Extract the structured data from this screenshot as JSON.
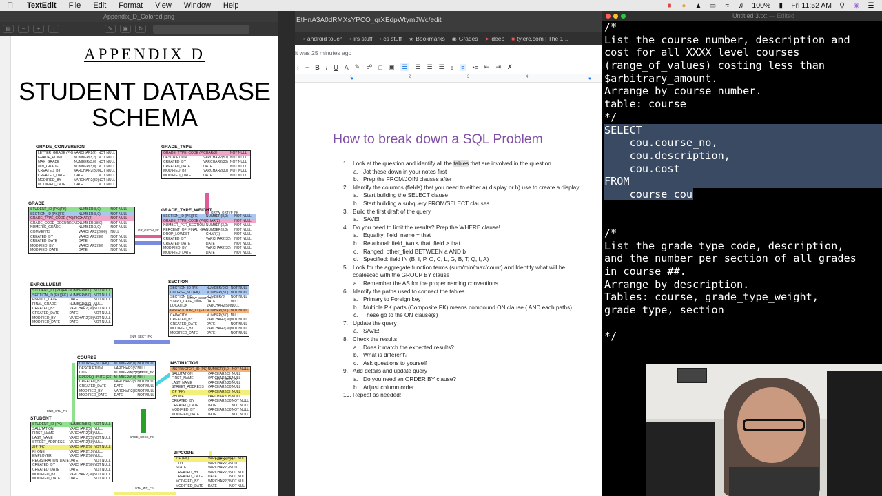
{
  "menubar": {
    "app_name": "TextEdit",
    "items": [
      "File",
      "Edit",
      "Format",
      "View",
      "Window",
      "Help"
    ],
    "battery": "100%",
    "clock": "Fri 11:52 AM"
  },
  "preview": {
    "filename": "Appendix_D_Colored.png",
    "appendix_title": "APPENDIX D",
    "schema_title_line1": "STUDENT DATABASE",
    "schema_title_line2": "SCHEMA",
    "tables": [
      {
        "name": "GRADE_CONVERSION",
        "rows": [
          [
            "LETTER_GRADE (PK)",
            "VARCHAR2(2)",
            "NOT NULL"
          ],
          [
            "GRADE_POINT",
            "NUMBER(3,2)",
            "NOT NULL"
          ],
          [
            "MAX_GRADE",
            "NUMBER(3,0)",
            "NOT NULL"
          ],
          [
            "MIN_GRADE",
            "NUMBER(3,0)",
            "NOT NULL"
          ],
          [
            "CREATED_BY",
            "VARCHAR2(30)",
            "NOT NULL"
          ],
          [
            "CREATED_DATE",
            "DATE",
            "NOT NULL"
          ],
          [
            "MODIFIED_BY",
            "VARCHAR2(30)",
            "NOT NULL"
          ],
          [
            "MODIFIED_DATE",
            "DATE",
            "NOT NULL"
          ]
        ]
      },
      {
        "name": "GRADE_TYPE",
        "rows": [
          [
            "GRADE_TYPE_CODE (PK)",
            "CHAR(2)",
            "NOT NULL"
          ],
          [
            "DESCRIPTION",
            "VARCHAR2(50)",
            "NOT NULL"
          ],
          [
            "CREATED_BY",
            "VARCHAR2(30)",
            "NOT NULL"
          ],
          [
            "CREATED_DATE",
            "DATE",
            "NOT NULL"
          ],
          [
            "MODIFIED_BY",
            "VARCHAR2(30)",
            "NOT NULL"
          ],
          [
            "MODIFIED_DATE",
            "DATE",
            "NOT NULL"
          ]
        ]
      },
      {
        "name": "GRADE",
        "rows": [
          [
            "STUDENT_ID (PK)(FK)",
            "NUMBER(8,0)",
            "NOT NULL"
          ],
          [
            "SECTION_ID (PK)(FK)",
            "NUMBER(8,0)",
            "NOT NULL"
          ],
          [
            "GRADE_TYPE_CODE (PK)(FK)",
            "CHAR(2)",
            "NOT NULL"
          ],
          [
            "GRADE_CODE_OCCURRENCE (PK)",
            "NUMBER(38,0)",
            "NOT NULL"
          ],
          [
            "NUMERIC_GRADE",
            "NUMBER(3,0)",
            "NOT NULL"
          ],
          [
            "COMMENTS",
            "VARCHAR2(2000)",
            "NULL"
          ],
          [
            "CREATED_BY",
            "VARCHAR2(30)",
            "NOT NULL"
          ],
          [
            "CREATED_DATE",
            "DATE",
            "NOT NULL"
          ],
          [
            "MODIFIED_BY",
            "VARCHAR2(30)",
            "NOT NULL"
          ],
          [
            "MODIFIED_DATE",
            "DATE",
            "NOT NULL"
          ]
        ]
      },
      {
        "name": "GRADE_TYPE_WEIGHT",
        "rows": [
          [
            "SECTION_ID (PK)(FK)",
            "NUMBER(8,0)",
            "NOT NULL"
          ],
          [
            "GRADE_TYPE_CODE (PK)(FK)",
            "CHAR(2)",
            "NOT NULL"
          ],
          [
            "NUMBER_PER_SECTION",
            "NUMBER(3,0)",
            "NOT NULL"
          ],
          [
            "PERCENT_OF_FINAL_GRADE",
            "NUMBER(3,0)",
            "NOT NULL"
          ],
          [
            "DROP_LOWEST",
            "CHAR(1)",
            "NOT NULL"
          ],
          [
            "CREATED_BY",
            "VARCHAR2(30)",
            "NOT NULL"
          ],
          [
            "CREATED_DATE",
            "DATE",
            "NOT NULL"
          ],
          [
            "MODIFIED_BY",
            "VARCHAR2(30)",
            "NOT NULL"
          ],
          [
            "MODIFIED_DATE",
            "DATE",
            "NOT NULL"
          ]
        ]
      },
      {
        "name": "ENROLLMENT",
        "rows": [
          [
            "STUDENT_ID (PK)(FK)",
            "NUMBER(8,0)",
            "NOT NULL"
          ],
          [
            "SECTION_ID (PK)(FK)",
            "NUMBER(8,0)",
            "NOT NULL"
          ],
          [
            "ENROLL_DATE",
            "DATE",
            "NOT NULL"
          ],
          [
            "FINAL_GRADE",
            "NUMBER(3,0)",
            "NULL"
          ],
          [
            "CREATED_BY",
            "VARCHAR2(30)",
            "NOT NULL"
          ],
          [
            "CREATED_DATE",
            "DATE",
            "NOT NULL"
          ],
          [
            "MODIFIED_BY",
            "VARCHAR2(30)",
            "NOT NULL"
          ],
          [
            "MODIFIED_DATE",
            "DATE",
            "NOT NULL"
          ]
        ]
      },
      {
        "name": "SECTION",
        "rows": [
          [
            "SECTION_ID (PK)",
            "NUMBER(8,0)",
            "NOT NULL"
          ],
          [
            "COURSE_NO (FK)",
            "NUMBER(8,0)",
            "NOT NULL"
          ],
          [
            "SECTION_NO",
            "NUMBER(3)",
            "NOT NULL"
          ],
          [
            "START_DATE_TIME",
            "DATE",
            "NULL"
          ],
          [
            "LOCATION",
            "VARCHAR2(50)",
            "NULL"
          ],
          [
            "INSTRUCTOR_ID (FK)",
            "NUMBER(8,0)",
            "NOT NULL"
          ],
          [
            "CAPACITY",
            "NUMBER(3,0)",
            "NULL"
          ],
          [
            "CREATED_BY",
            "VARCHAR2(30)",
            "NOT NULL"
          ],
          [
            "CREATED_DATE",
            "DATE",
            "NOT NULL"
          ],
          [
            "MODIFIED_BY",
            "VARCHAR2(30)",
            "NOT NULL"
          ],
          [
            "MODIFIED_DATE",
            "DATE",
            "NOT NULL"
          ]
        ]
      },
      {
        "name": "COURSE",
        "rows": [
          [
            "COURSE_NO (PK)",
            "NUMBER(8,0)",
            "NOT NULL"
          ],
          [
            "DESCRIPTION",
            "VARCHAR2(50)",
            "NULL"
          ],
          [
            "COST",
            "NUMBER(9,2)",
            "NULL"
          ],
          [
            "PREREQUISITE (FK)",
            "NUMBER(8,0)",
            "NULL"
          ],
          [
            "CREATED_BY",
            "VARCHAR2(30)",
            "NOT NULL"
          ],
          [
            "CREATED_DATE",
            "DATE",
            "NOT NULL"
          ],
          [
            "MODIFIED_BY",
            "VARCHAR2(30)",
            "NOT NULL"
          ],
          [
            "MODIFIED_DATE",
            "DATE",
            "NOT NULL"
          ]
        ]
      },
      {
        "name": "INSTRUCTOR",
        "rows": [
          [
            "INSTRUCTOR_ID (PK)",
            "NUMBER(8,0)",
            "NOT NULL"
          ],
          [
            "SALUTATION",
            "VARCHAR2(5)",
            "NULL"
          ],
          [
            "FIRST_NAME",
            "VARCHAR2(25)",
            "NULL"
          ],
          [
            "LAST_NAME",
            "VARCHAR2(25)",
            "NULL"
          ],
          [
            "STREET_ADDRESS",
            "VARCHAR2(50)",
            "NULL"
          ],
          [
            "ZIP (FK)",
            "VARCHAR2(5)",
            "NULL"
          ],
          [
            "PHONE",
            "VARCHAR2(15)",
            "NULL"
          ],
          [
            "CREATED_BY",
            "VARCHAR2(30)",
            "NOT NULL"
          ],
          [
            "CREATED_DATE",
            "DATE",
            "NOT NULL"
          ],
          [
            "MODIFIED_BY",
            "VARCHAR2(30)",
            "NOT NULL"
          ],
          [
            "MODIFIED_DATE",
            "DATE",
            "NOT NULL"
          ]
        ]
      },
      {
        "name": "STUDENT",
        "rows": [
          [
            "STUDENT_ID (PK)",
            "NUMBER(8,0)",
            "NOT NULL"
          ],
          [
            "SALUTATION",
            "VARCHAR2(5)",
            "NULL"
          ],
          [
            "FIRST_NAME",
            "VARCHAR2(25)",
            "NULL"
          ],
          [
            "LAST_NAME",
            "VARCHAR2(25)",
            "NOT NULL"
          ],
          [
            "STREET_ADDRESS",
            "VARCHAR2(50)",
            "NULL"
          ],
          [
            "ZIP (FK)",
            "VARCHAR2(5)",
            "NOT NULL"
          ],
          [
            "PHONE",
            "VARCHAR2(15)",
            "NULL"
          ],
          [
            "EMPLOYER",
            "VARCHAR2(50)",
            "NULL"
          ],
          [
            "REGISTRATION_DATE",
            "DATE",
            "NOT NULL"
          ],
          [
            "CREATED_BY",
            "VARCHAR2(30)",
            "NOT NULL"
          ],
          [
            "CREATED_DATE",
            "DATE",
            "NOT NULL"
          ],
          [
            "MODIFIED_BY",
            "VARCHAR2(30)",
            "NOT NULL"
          ],
          [
            "MODIFIED_DATE",
            "DATE",
            "NOT NULL"
          ]
        ]
      },
      {
        "name": "ZIPCODE",
        "rows": [
          [
            "ZIP (PK)",
            "VARCHAR2(5)",
            "NOT NULL"
          ],
          [
            "CITY",
            "VARCHAR2(25)",
            "NULL"
          ],
          [
            "STATE",
            "VARCHAR2(2)",
            "NULL"
          ],
          [
            "CREATED_BY",
            "VARCHAR2(30)",
            "NOT NULL"
          ],
          [
            "CREATED_DATE",
            "DATE",
            "NOT NULL"
          ],
          [
            "MODIFIED_BY",
            "VARCHAR2(30)",
            "NOT NULL"
          ],
          [
            "MODIFIED_DATE",
            "DATE",
            "NOT NULL"
          ]
        ]
      }
    ],
    "relation_labels": [
      "GRTW_GRTYP_FK",
      "GR_GRTW_FK",
      "GRTW_SECT_FK",
      "GR_ENR_FK",
      "ENR_SECT_FK",
      "SECT_CRSE_FK",
      "SECT_INST_FK",
      "ENR_STU_FK",
      "CRSE_CRSE_FK",
      "INST_ZIP_FK",
      "STU_ZIP_FK"
    ]
  },
  "browser": {
    "url": "EtHnA3A0dRMXsYPCO_qrXEdpWtymJWc/edit",
    "bookmarks": [
      "android touch",
      "irs stuff",
      "cs stuff",
      "Bookmarks",
      "Grades",
      "deep",
      "tylerc.com | The 1..."
    ],
    "last_edit": "it was 25 minutes ago",
    "doc_heading": "How to break down a SQL Problem",
    "steps": [
      {
        "num": "1.",
        "text_before": "Look at the question and identify all the ",
        "highlight": "tables",
        "text_after": " that are involved in the question.",
        "subs": [
          {
            "let": "a.",
            "text": "Jot these down in your notes first"
          },
          {
            "let": "b.",
            "text": "Prep the FROM/JOIN clauses after"
          }
        ]
      },
      {
        "num": "2.",
        "text_before": "Identify the columns (fields) that you need to either  a) display or b) use to create a display",
        "highlight": "",
        "text_after": "",
        "subs": [
          {
            "let": "a.",
            "text": "Start building the SELECT clause"
          },
          {
            "let": "b.",
            "text": "Start building a subquery FROM/SELECT clauses"
          }
        ]
      },
      {
        "num": "3.",
        "text_before": "Build the first draft of the query",
        "highlight": "",
        "text_after": "",
        "subs": [
          {
            "let": "a.",
            "text": "SAVE!"
          }
        ]
      },
      {
        "num": "4.",
        "text_before": "Do you need to limit the results? Prep the WHERE clause!",
        "highlight": "",
        "text_after": "",
        "subs": [
          {
            "let": "a.",
            "text": "Equality: field_name = that"
          },
          {
            "let": "b.",
            "text": "Relational: field_two < that, field > that"
          },
          {
            "let": "c.",
            "text": "Ranged: other_field BETWEEN a AND b"
          },
          {
            "let": "d.",
            "text": "Specified: field IN (B, I, P, O, C, L, G, B, T, Q, I, A)"
          }
        ]
      },
      {
        "num": "5.",
        "text_before": "Look for the aggregate function terms (sum/min/max/count) and Identify what will be coalesced with the GROUP BY clause",
        "highlight": "",
        "text_after": "",
        "subs": [
          {
            "let": "a.",
            "text": "Remember the AS for the proper naming conventions"
          }
        ]
      },
      {
        "num": "6.",
        "text_before": "Identify the paths used to connect the tables",
        "highlight": "",
        "text_after": "",
        "subs": [
          {
            "let": "a.",
            "text": "Primary to Foreign key"
          },
          {
            "let": "b.",
            "text": "Multiple PK parts (Composite PK) means compound ON clause ( AND each paths)"
          },
          {
            "let": "c.",
            "text": "These go to the ON clause(s)"
          }
        ]
      },
      {
        "num": "7.",
        "text_before": "Update the query",
        "highlight": "",
        "text_after": "",
        "subs": [
          {
            "let": "a.",
            "text": "SAVE!"
          }
        ]
      },
      {
        "num": "8.",
        "text_before": "Check the results",
        "highlight": "",
        "text_after": "",
        "subs": [
          {
            "let": "a.",
            "text": "Does it match the expected results?"
          },
          {
            "let": "b.",
            "text": "What is different?"
          },
          {
            "let": "c.",
            "text": "Ask questions to yourself"
          }
        ]
      },
      {
        "num": "9.",
        "text_before": "Add details and update query",
        "highlight": "",
        "text_after": "",
        "subs": [
          {
            "let": "a.",
            "text": "Do you need an ORDER BY clause?"
          },
          {
            "let": "b.",
            "text": "Adjust column order"
          }
        ]
      },
      {
        "num": "10.",
        "text_before": "Repeat as needed!",
        "highlight": "",
        "text_after": "",
        "subs": []
      }
    ]
  },
  "textedit": {
    "title": "Untitled 3.txt",
    "status": "— Edited",
    "lines": [
      {
        "text": "/*",
        "selected": false
      },
      {
        "text": "List the course number, description and",
        "selected": false
      },
      {
        "text": "cost for all XXXX level courses",
        "selected": false
      },
      {
        "text": "(range_of_values) costing less than",
        "selected": false
      },
      {
        "text": "$arbitrary_amount.",
        "selected": false
      },
      {
        "text": "Arrange by course number.",
        "selected": false
      },
      {
        "text": "table: course",
        "selected": false
      },
      {
        "text": "*/",
        "selected": false
      },
      {
        "text": "SELECT",
        "selected": true
      },
      {
        "text": "    cou.course_no,",
        "selected": true
      },
      {
        "text": "    cou.description,",
        "selected": true
      },
      {
        "text": "    cou.cost",
        "selected": true
      },
      {
        "text": "FROM",
        "selected": true
      },
      {
        "text": "    course cou",
        "selected": "partial"
      },
      {
        "text": "",
        "selected": false
      },
      {
        "text": "",
        "selected": false
      },
      {
        "text": "/*",
        "selected": false
      },
      {
        "text": "List the grade type code, description,",
        "selected": false
      },
      {
        "text": "and the number per section of all grades",
        "selected": false
      },
      {
        "text": "in course ##.",
        "selected": false
      },
      {
        "text": "Arrange by description.",
        "selected": false
      },
      {
        "text": "Tables: course, grade_type_weight,",
        "selected": false
      },
      {
        "text": "grade_type, section",
        "selected": false
      },
      {
        "text": "",
        "selected": false
      },
      {
        "text": "*/",
        "selected": false
      }
    ]
  },
  "colors": {
    "doc_heading": "#7f4fa5",
    "selection": "#3a4a63",
    "highlight_pink": "#f0a6c8",
    "highlight_blue": "#a9c7ef",
    "highlight_green": "#8fe08f",
    "highlight_orange": "#f3b27a",
    "highlight_yellow": "#f4ee7a"
  }
}
